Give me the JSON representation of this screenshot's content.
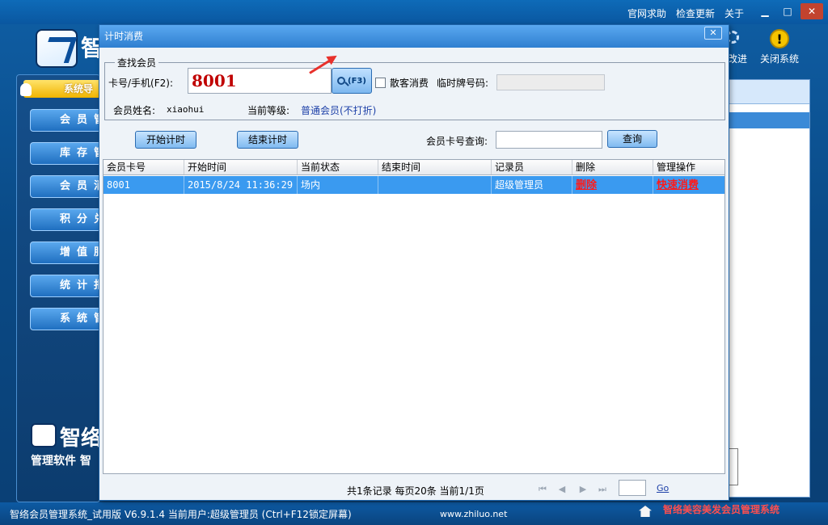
{
  "app": {
    "top_links": [
      "官网求助",
      "检查更新",
      "关于"
    ],
    "logo_char": "智",
    "toolbar": {
      "upgrade_label": "改进",
      "close_system_label": "关闭系统"
    },
    "nav_header": "系统导",
    "nav_items": [
      "会员管",
      "库存管",
      "会员消",
      "积分兑",
      "增值服",
      "统计报",
      "系统管"
    ],
    "bottom_logo_text": "智络",
    "bottom_slogan": "管理软件 智",
    "status": {
      "left": "智络会员管理系统_试用版 V6.9.1.4 当前用户:超级管理员 (Ctrl+F12锁定屏幕)",
      "url": "www.zhiluo.net",
      "brand": "智络美容美发会员管理系统"
    }
  },
  "dialog": {
    "title": "计时消费",
    "search_group": {
      "legend": "查找会员",
      "card_label": "卡号/手机(F2):",
      "card_value": "8001",
      "search_button": "(F3)",
      "walkin_label": "散客消费",
      "temp_tag_label": "临时牌号码:",
      "temp_tag_value": "",
      "member_name_label": "会员姓名:",
      "member_name_value": "xiaohui",
      "level_label": "当前等级:",
      "level_value": "普通会员(不打折)"
    },
    "actions": {
      "start_label": "开始计时",
      "end_label": "结束计时",
      "query_label": "会员卡号查询:",
      "query_value": "",
      "query_button": "查询"
    },
    "grid": {
      "columns": [
        "会员卡号",
        "开始时间",
        "当前状态",
        "结束时间",
        "记录员",
        "删除",
        "管理操作"
      ],
      "rows": [
        {
          "card": "8001",
          "start": "2015/8/24 11:36:29",
          "state": "场内",
          "end": "",
          "recorder": "超级管理员",
          "delete": "删除",
          "action": "快速消费"
        }
      ]
    },
    "pager": {
      "info": "共1条记录 每页20条 当前1/1页",
      "page_value": "",
      "go_label": "Go"
    }
  },
  "colors": {
    "accent": "#2f7fd0",
    "selected_row": "#3a9af0",
    "danger": "#ff1a1a",
    "card_text": "#c00000"
  },
  "icons": [
    "search-icon",
    "warning-icon",
    "home-icon",
    "first-page-icon",
    "prev-page-icon",
    "next-page-icon",
    "last-page-icon",
    "close-icon"
  ]
}
